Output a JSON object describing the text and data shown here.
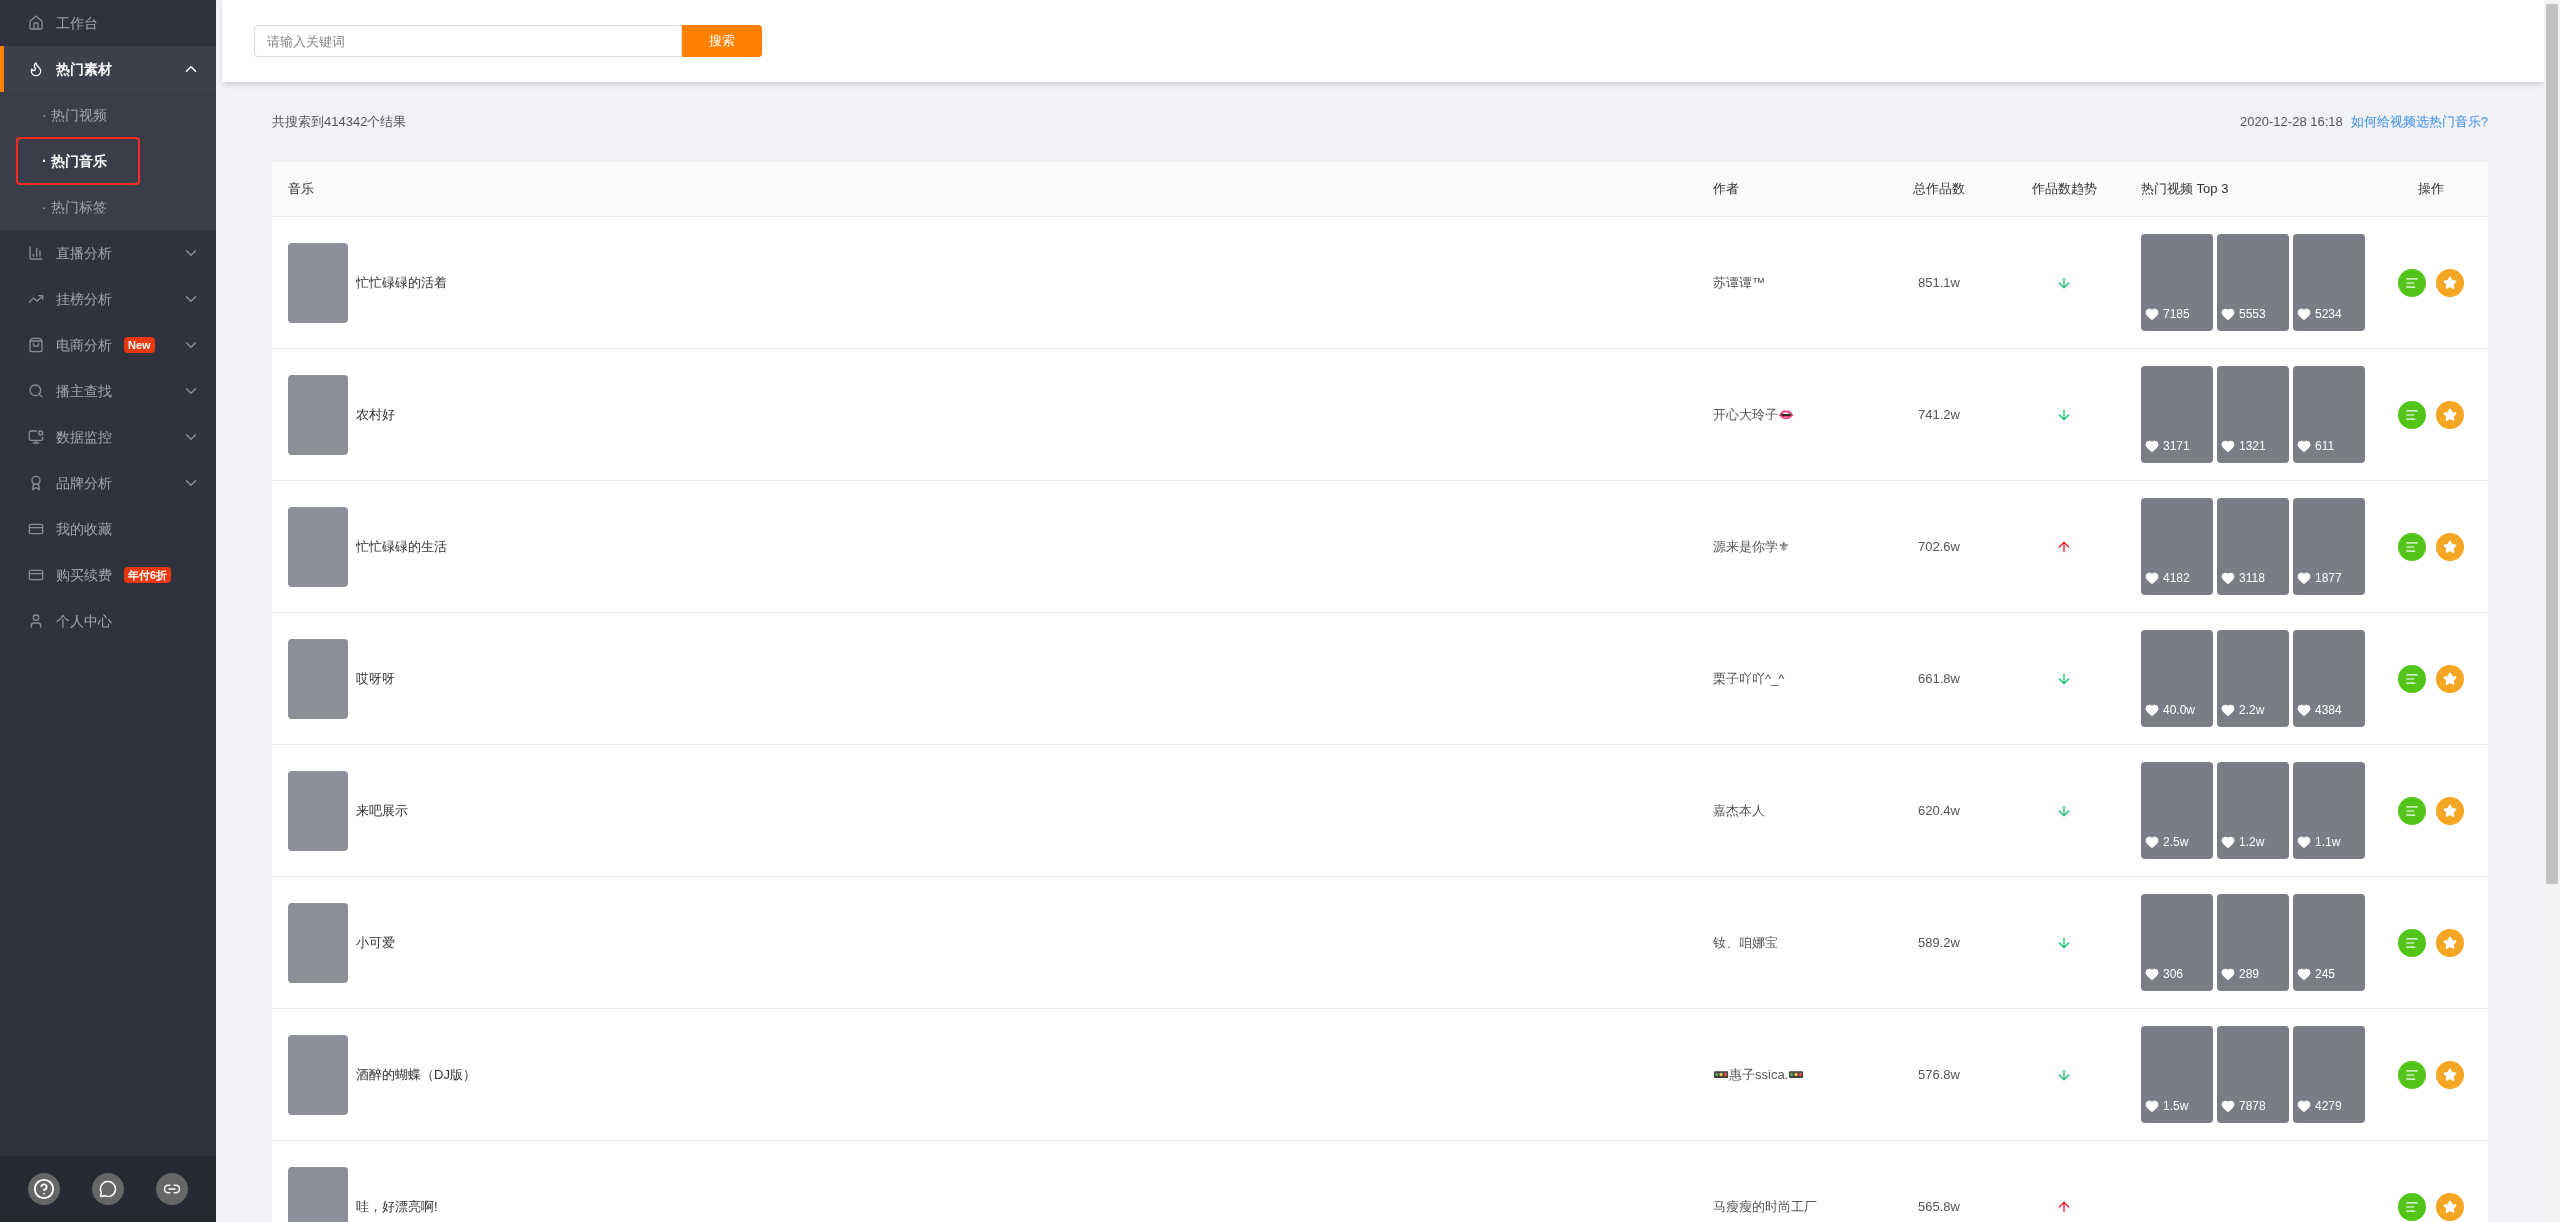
{
  "sidebar": {
    "items": [
      {
        "label": "工作台",
        "kind": "item"
      },
      {
        "label": "热门素材",
        "kind": "group",
        "expanded": true,
        "active": true,
        "children": [
          {
            "label": "· 热门视频",
            "selected": false,
            "annotated": false
          },
          {
            "label": "· 热门音乐",
            "selected": true,
            "annotated": true
          },
          {
            "label": "· 热门标签",
            "selected": false,
            "annotated": false
          }
        ]
      },
      {
        "label": "直播分析",
        "kind": "group",
        "expanded": false,
        "active": false
      },
      {
        "label": "挂榜分析",
        "kind": "group",
        "expanded": false,
        "active": false
      },
      {
        "label": "电商分析",
        "kind": "group",
        "expanded": false,
        "active": false,
        "badge": "New"
      },
      {
        "label": "播主查找",
        "kind": "group",
        "expanded": false,
        "active": false
      },
      {
        "label": "数据监控",
        "kind": "group",
        "expanded": false,
        "active": false
      },
      {
        "label": "品牌分析",
        "kind": "group",
        "expanded": false,
        "active": false
      },
      {
        "label": "我的收藏",
        "kind": "item"
      },
      {
        "label": "购买续费",
        "kind": "item",
        "badge": "年付6折"
      },
      {
        "label": "个人中心",
        "kind": "item"
      }
    ]
  },
  "search": {
    "placeholder": "请输入关键词",
    "button": "搜索"
  },
  "result_count": "共搜索到414342个结果",
  "updated": "2020-12-28 16:18",
  "help_link": "如何给视频选热门音乐?",
  "table": {
    "columns": [
      "音乐",
      "作者",
      "总作品数",
      "作品数趋势",
      "热门视频 Top 3",
      "操作"
    ],
    "rows": [
      {
        "music": "忙忙碌碌的活着",
        "author": "苏谭谭™",
        "works": "851.1w",
        "rising": false,
        "videos": [
          "7185",
          "5553",
          "5234"
        ]
      },
      {
        "music": "农村好",
        "author": "开心大玲子👄",
        "works": "741.2w",
        "rising": false,
        "videos": [
          "3171",
          "1321",
          "611"
        ]
      },
      {
        "music": "忙忙碌碌的生活",
        "author": "源来是你学⚜",
        "works": "702.6w",
        "rising": true,
        "videos": [
          "4182",
          "3118",
          "1877"
        ]
      },
      {
        "music": "哎呀呀",
        "author": "栗子吖吖^_^",
        "works": "661.8w",
        "rising": false,
        "videos": [
          "40.0w",
          "2.2w",
          "4384"
        ]
      },
      {
        "music": "来吧展示",
        "author": "嘉杰本人",
        "works": "620.4w",
        "rising": false,
        "videos": [
          "2.5w",
          "1.2w",
          "1.1w"
        ]
      },
      {
        "music": "小可爱",
        "author": "钕、咱娜宝",
        "works": "589.2w",
        "rising": false,
        "videos": [
          "306",
          "289",
          "245"
        ]
      },
      {
        "music": "酒醉的蝴蝶（DJ版）",
        "author": "🚥惠子ssica.🚥",
        "works": "576.8w",
        "rising": false,
        "videos": [
          "1.5w",
          "7878",
          "4279"
        ]
      },
      {
        "music": "哇，好漂亮啊!",
        "author": "马瘦瘦的时尚工厂",
        "works": "565.8w",
        "rising": true,
        "videos": []
      }
    ]
  }
}
